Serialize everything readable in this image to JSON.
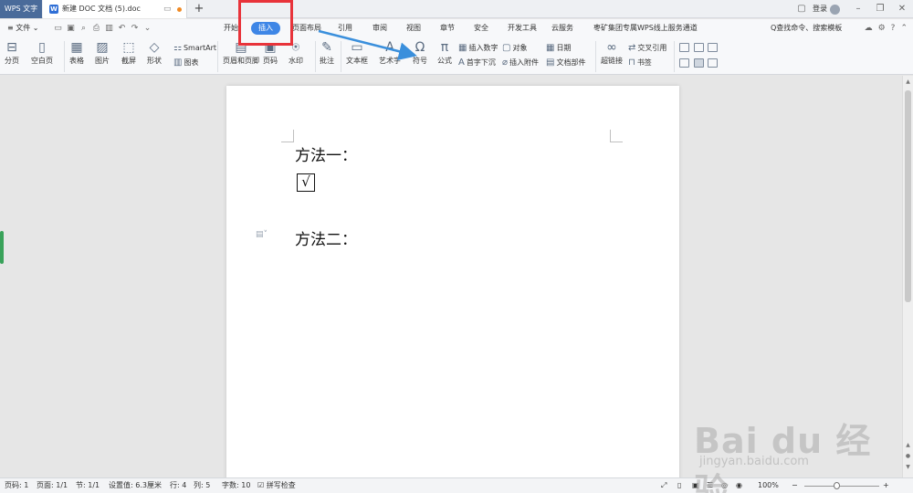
{
  "titlebar": {
    "app_label": "WPS 文字",
    "doc_title": "新建 DOC 文档 (5).doc",
    "new_tab_symbol": "+",
    "login_label": "登录"
  },
  "menu": {
    "file_label": "≡ 文件 ⌄",
    "tabs": [
      "开始",
      "插入",
      "页面布局",
      "引用",
      "审阅",
      "视图",
      "章节",
      "安全",
      "开发工具",
      "云服务",
      "枣矿集团专属WPS线上服务通道"
    ],
    "active_tab": "插入",
    "search_label": "Q查找命令、搜索模板"
  },
  "ribbon": {
    "fenye": "分页",
    "kongbaiye": "空白页",
    "biaoge": "表格",
    "tupian": "图片",
    "jieping": "截屏",
    "xingzhuang": "形状",
    "smartart": "SmartArt",
    "tubiao": "图表",
    "yemeiheyejiao": "页眉和页脚",
    "yema": "页码",
    "shuiyin": "水印",
    "pizhu": "批注",
    "wenbenkuang": "文本框",
    "yishuzi": "艺术字",
    "fuhao": "符号",
    "gongshi": "公式",
    "charushuzi": "插入数字",
    "shouzixiachen": "首字下沉",
    "duixiang": "对象",
    "charufujian": "插入附件",
    "riqi": "日期",
    "wendangbujian": "文档部件",
    "chaolianjie": "超链接",
    "jiaochayinyong": "交叉引用",
    "shuqian": "书签"
  },
  "document": {
    "line1": "方法一：",
    "checkbox_mark": "√",
    "line2": "方法二："
  },
  "statusbar": {
    "page_num": "页码: 1",
    "pages": "页面: 1/1",
    "section": "节: 1/1",
    "setting": "设置值: 6.3厘米",
    "row": "行: 4",
    "col": "列: 5",
    "wordcount": "字数: 10",
    "spellcheck": "拼写检查",
    "zoom": "100%"
  },
  "watermark": {
    "logo": "Bai du 经验",
    "url": "jingyan.baidu.com"
  },
  "colors": {
    "accent": "#3e86e6",
    "annotation": "#e8333a",
    "arrow": "#3a8fdc"
  }
}
